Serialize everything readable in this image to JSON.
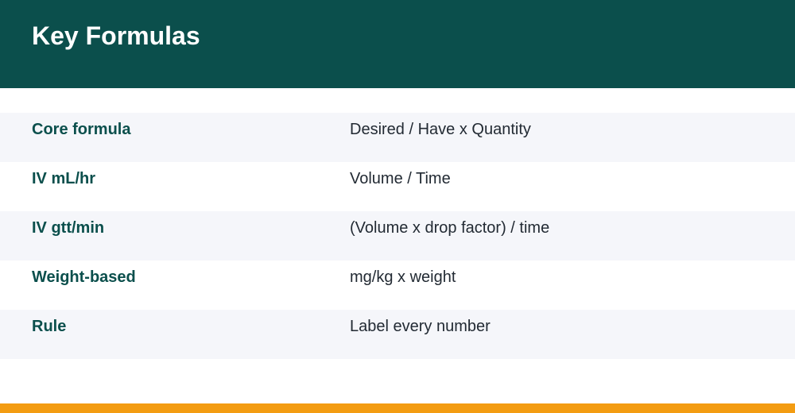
{
  "title": "Key Formulas",
  "rows": [
    {
      "label": "Core formula",
      "value": "Desired / Have x Quantity"
    },
    {
      "label": "IV mL/hr",
      "value": "Volume / Time"
    },
    {
      "label": "IV gtt/min",
      "value": "(Volume x drop factor) / time"
    },
    {
      "label": "Weight-based",
      "value": "mg/kg x weight"
    },
    {
      "label": "Rule",
      "value": "Label every number"
    }
  ],
  "colors": {
    "header_background": "#0b4f4c",
    "label_text": "#0b4f4c",
    "value_text": "#222a33",
    "row_shade": "#f5f6fa",
    "accent_bar": "#f39c12"
  }
}
